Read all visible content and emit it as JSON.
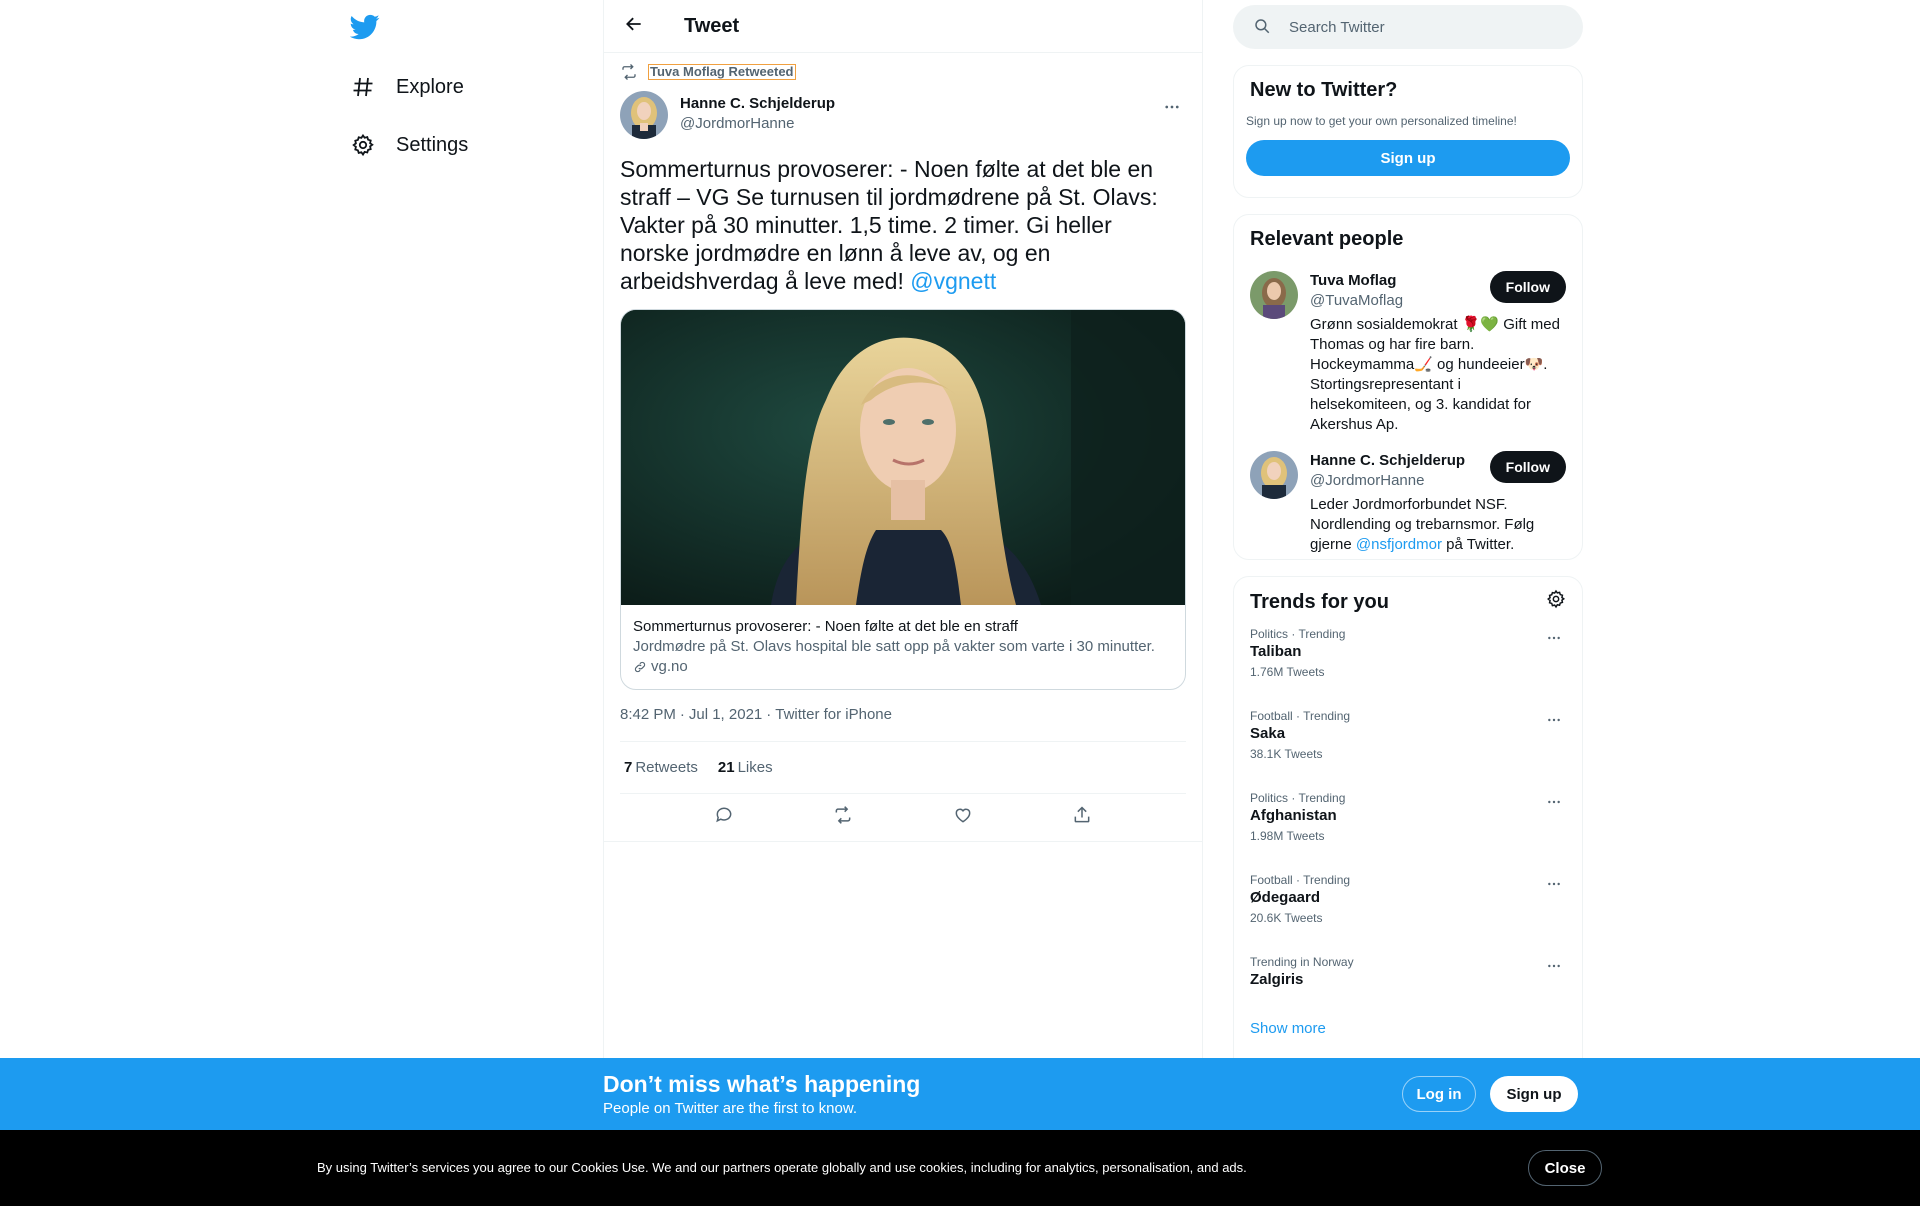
{
  "nav": {
    "logo_icon": "twitter-bird-icon",
    "items": [
      {
        "label": "Explore",
        "icon": "hashtag-icon"
      },
      {
        "label": "Settings",
        "icon": "gear-icon"
      }
    ]
  },
  "header": {
    "title": "Tweet",
    "back_icon": "arrow-left-icon"
  },
  "tweet": {
    "retweeted_by": "Tuva Moflag Retweeted",
    "author_name": "Hanne C. Schjelderup",
    "author_handle": "@JordmorHanne",
    "text": "Sommerturnus provoserer: - Noen følte at det ble en straff – VG Se turnusen til jordmødrene på St. Olavs: Vakter på 30 minutter. 1,5 time. 2 timer. Gi heller norske jordmødre en lønn å leve av, og en arbeidshverdag å leve med!",
    "mention": "@vgnett",
    "card": {
      "title": "Sommerturnus provoserer: - Noen følte at det ble en straff",
      "description": "Jordmødre på St. Olavs hospital ble satt opp på vakter som varte i 30 minutter.",
      "domain": "vg.no"
    },
    "time": "8:42 PM",
    "date": "Jul 1, 2021",
    "source": "Twitter for iPhone",
    "retweets_count": "7",
    "retweets_label": "Retweets",
    "likes_count": "21",
    "likes_label": "Likes"
  },
  "search": {
    "placeholder": "Search Twitter"
  },
  "new_to_twitter": {
    "title": "New to Twitter?",
    "subtitle": "Sign up now to get your own personalized timeline!",
    "button": "Sign up"
  },
  "relevant_people": {
    "title": "Relevant people",
    "people": [
      {
        "name": "Tuva Moflag",
        "handle": "@TuvaMoflag",
        "bio": "Grønn sosialdemokrat 🌹💚 Gift med Thomas og har fire barn. Hockeymamma🏒 og hundeeier🐶. Stortingsrepresentant i helsekomiteen, og 3. kandidat for Akershus Ap.",
        "follow": "Follow"
      },
      {
        "name": "Hanne C. Schjelderup",
        "handle": "@JordmorHanne",
        "bio_before": "Leder Jordmorforbundet NSF. Nordlending og trebarnsmor. Følg gjerne",
        "bio_mention": "@nsfjordmor",
        "bio_after": "på Twitter.",
        "follow": "Follow"
      }
    ]
  },
  "trends": {
    "title": "Trends for you",
    "items": [
      {
        "context": "Politics · Trending",
        "name": "Taliban",
        "count": "1.76M Tweets"
      },
      {
        "context": "Football · Trending",
        "name": "Saka",
        "count": "38.1K Tweets"
      },
      {
        "context": "Politics · Trending",
        "name": "Afghanistan",
        "count": "1.98M Tweets"
      },
      {
        "context": "Football · Trending",
        "name": "Ødegaard",
        "count": "20.6K Tweets"
      },
      {
        "context": "Trending in Norway",
        "name": "Zalgiris",
        "count": ""
      }
    ],
    "show_more": "Show more"
  },
  "signup_bar": {
    "title": "Don’t miss what’s happening",
    "subtitle": "People on Twitter are the first to know.",
    "login": "Log in",
    "signup": "Sign up"
  },
  "cookie_bar": {
    "text": "By using Twitter’s services you agree to our Cookies Use. We and our partners operate globally and use cookies, including for analytics, personalisation, and ads.",
    "close": "Close"
  },
  "colors": {
    "accent": "#1d9bf0",
    "text": "#0f1419",
    "secondary": "#536471"
  }
}
